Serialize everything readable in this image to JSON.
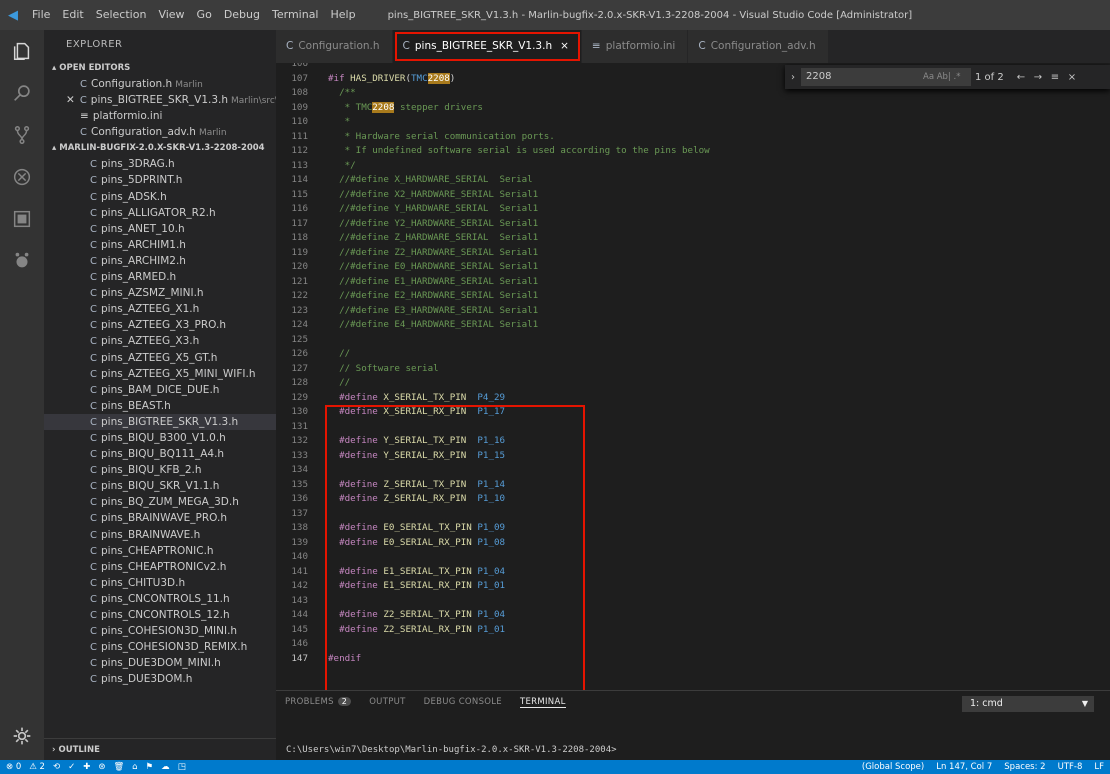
{
  "titlebar": {
    "menu": [
      "File",
      "Edit",
      "Selection",
      "View",
      "Go",
      "Debug",
      "Terminal",
      "Help"
    ],
    "window_title": "pins_BIGTREE_SKR_V1.3.h - Marlin-bugfix-2.0.x-SKR-V1.3-2208-2004 - Visual Studio Code [Administrator]"
  },
  "activity_icons": [
    "files-icon",
    "search-icon",
    "source-control-icon",
    "debug-icon",
    "extensions-icon",
    "remote-icon"
  ],
  "sidebar": {
    "header": "EXPLORER",
    "open_editors_title": "OPEN EDITORS",
    "open_editors": [
      {
        "type": "C",
        "name": "Configuration.h",
        "path": "Marlin",
        "active": false
      },
      {
        "type": "C",
        "name": "pins_BIGTREE_SKR_V1.3.h",
        "path": "Marlin\\src\\p...",
        "active": true
      },
      {
        "type": "≡",
        "name": "platformio.ini",
        "path": "",
        "active": false
      },
      {
        "type": "C",
        "name": "Configuration_adv.h",
        "path": "Marlin",
        "active": false
      }
    ],
    "folder_title": "MARLIN-BUGFIX-2.0.X-SKR-V1.3-2208-2004",
    "files": [
      "pins_3DRAG.h",
      "pins_5DPRINT.h",
      "pins_ADSK.h",
      "pins_ALLIGATOR_R2.h",
      "pins_ANET_10.h",
      "pins_ARCHIM1.h",
      "pins_ARCHIM2.h",
      "pins_ARMED.h",
      "pins_AZSMZ_MINI.h",
      "pins_AZTEEG_X1.h",
      "pins_AZTEEG_X3_PRO.h",
      "pins_AZTEEG_X3.h",
      "pins_AZTEEG_X5_GT.h",
      "pins_AZTEEG_X5_MINI_WIFI.h",
      "pins_BAM_DICE_DUE.h",
      "pins_BEAST.h",
      "pins_BIGTREE_SKR_V1.3.h",
      "pins_BIQU_B300_V1.0.h",
      "pins_BIQU_BQ111_A4.h",
      "pins_BIQU_KFB_2.h",
      "pins_BIQU_SKR_V1.1.h",
      "pins_BQ_ZUM_MEGA_3D.h",
      "pins_BRAINWAVE_PRO.h",
      "pins_BRAINWAVE.h",
      "pins_CHEAPTRONIC.h",
      "pins_CHEAPTRONICv2.h",
      "pins_CHITU3D.h",
      "pins_CNCONTROLS_11.h",
      "pins_CNCONTROLS_12.h",
      "pins_COHESION3D_MINI.h",
      "pins_COHESION3D_REMIX.h",
      "pins_DUE3DOM_MINI.h",
      "pins_DUE3DOM.h"
    ],
    "selected_file": "pins_BIGTREE_SKR_V1.3.h",
    "outline_title": "OUTLINE"
  },
  "tabs": [
    {
      "type": "C",
      "label": "Configuration.h",
      "active": false
    },
    {
      "type": "C",
      "label": "pins_BIGTREE_SKR_V1.3.h",
      "active": true
    },
    {
      "type": "≡",
      "label": "platformio.ini",
      "active": false
    },
    {
      "type": "C",
      "label": "Configuration_adv.h",
      "active": false
    }
  ],
  "find": {
    "query": "2208",
    "options": "Aa  Ab|  .*",
    "count": "1 of 2"
  },
  "code_lines": [
    {
      "n": "106",
      "tokens": []
    },
    {
      "n": "107",
      "tokens": [
        [
          "kw",
          "#if "
        ],
        [
          "mac",
          "HAS_DRIVER"
        ],
        [
          "pl",
          "("
        ],
        [
          "nm",
          "TMC"
        ],
        [
          "hl",
          "2208"
        ],
        [
          "pl",
          ")"
        ]
      ]
    },
    {
      "n": "108",
      "tokens": [
        [
          "cm",
          "  /**"
        ]
      ]
    },
    {
      "n": "109",
      "tokens": [
        [
          "cm",
          "   * TMC"
        ],
        [
          "hl",
          "2208"
        ],
        [
          "cm",
          " stepper drivers"
        ]
      ]
    },
    {
      "n": "110",
      "tokens": [
        [
          "cm",
          "   *"
        ]
      ]
    },
    {
      "n": "111",
      "tokens": [
        [
          "cm",
          "   * Hardware serial communication ports."
        ]
      ]
    },
    {
      "n": "112",
      "tokens": [
        [
          "cm",
          "   * If undefined software serial is used according to the pins below"
        ]
      ]
    },
    {
      "n": "113",
      "tokens": [
        [
          "cm",
          "   */"
        ]
      ]
    },
    {
      "n": "114",
      "tokens": [
        [
          "cm",
          "  //#define X_HARDWARE_SERIAL  Serial"
        ]
      ]
    },
    {
      "n": "115",
      "tokens": [
        [
          "cm",
          "  //#define X2_HARDWARE_SERIAL Serial1"
        ]
      ]
    },
    {
      "n": "116",
      "tokens": [
        [
          "cm",
          "  //#define Y_HARDWARE_SERIAL  Serial1"
        ]
      ]
    },
    {
      "n": "117",
      "tokens": [
        [
          "cm",
          "  //#define Y2_HARDWARE_SERIAL Serial1"
        ]
      ]
    },
    {
      "n": "118",
      "tokens": [
        [
          "cm",
          "  //#define Z_HARDWARE_SERIAL  Serial1"
        ]
      ]
    },
    {
      "n": "119",
      "tokens": [
        [
          "cm",
          "  //#define Z2_HARDWARE_SERIAL Serial1"
        ]
      ]
    },
    {
      "n": "120",
      "tokens": [
        [
          "cm",
          "  //#define E0_HARDWARE_SERIAL Serial1"
        ]
      ]
    },
    {
      "n": "121",
      "tokens": [
        [
          "cm",
          "  //#define E1_HARDWARE_SERIAL Serial1"
        ]
      ]
    },
    {
      "n": "122",
      "tokens": [
        [
          "cm",
          "  //#define E2_HARDWARE_SERIAL Serial1"
        ]
      ]
    },
    {
      "n": "123",
      "tokens": [
        [
          "cm",
          "  //#define E3_HARDWARE_SERIAL Serial1"
        ]
      ]
    },
    {
      "n": "124",
      "tokens": [
        [
          "cm",
          "  //#define E4_HARDWARE_SERIAL Serial1"
        ]
      ]
    },
    {
      "n": "125",
      "tokens": []
    },
    {
      "n": "126",
      "tokens": [
        [
          "cm",
          "  //"
        ]
      ]
    },
    {
      "n": "127",
      "tokens": [
        [
          "cm",
          "  // Software serial"
        ]
      ]
    },
    {
      "n": "128",
      "tokens": [
        [
          "cm",
          "  //"
        ]
      ]
    },
    {
      "n": "129",
      "tokens": [
        [
          "kw",
          "  #define "
        ],
        [
          "mac",
          "X_SERIAL_TX_PIN"
        ],
        [
          "pl",
          "  "
        ],
        [
          "nm",
          "P4_29"
        ]
      ]
    },
    {
      "n": "130",
      "tokens": [
        [
          "kw",
          "  #define "
        ],
        [
          "mac",
          "X_SERIAL_RX_PIN"
        ],
        [
          "pl",
          "  "
        ],
        [
          "nm",
          "P1_17"
        ]
      ]
    },
    {
      "n": "131",
      "tokens": []
    },
    {
      "n": "132",
      "tokens": [
        [
          "kw",
          "  #define "
        ],
        [
          "mac",
          "Y_SERIAL_TX_PIN"
        ],
        [
          "pl",
          "  "
        ],
        [
          "nm",
          "P1_16"
        ]
      ]
    },
    {
      "n": "133",
      "tokens": [
        [
          "kw",
          "  #define "
        ],
        [
          "mac",
          "Y_SERIAL_RX_PIN"
        ],
        [
          "pl",
          "  "
        ],
        [
          "nm",
          "P1_15"
        ]
      ]
    },
    {
      "n": "134",
      "tokens": []
    },
    {
      "n": "135",
      "tokens": [
        [
          "kw",
          "  #define "
        ],
        [
          "mac",
          "Z_SERIAL_TX_PIN"
        ],
        [
          "pl",
          "  "
        ],
        [
          "nm",
          "P1_14"
        ]
      ]
    },
    {
      "n": "136",
      "tokens": [
        [
          "kw",
          "  #define "
        ],
        [
          "mac",
          "Z_SERIAL_RX_PIN"
        ],
        [
          "pl",
          "  "
        ],
        [
          "nm",
          "P1_10"
        ]
      ]
    },
    {
      "n": "137",
      "tokens": []
    },
    {
      "n": "138",
      "tokens": [
        [
          "kw",
          "  #define "
        ],
        [
          "mac",
          "E0_SERIAL_TX_PIN"
        ],
        [
          "pl",
          " "
        ],
        [
          "nm",
          "P1_09"
        ]
      ]
    },
    {
      "n": "139",
      "tokens": [
        [
          "kw",
          "  #define "
        ],
        [
          "mac",
          "E0_SERIAL_RX_PIN"
        ],
        [
          "pl",
          " "
        ],
        [
          "nm",
          "P1_08"
        ]
      ]
    },
    {
      "n": "140",
      "tokens": []
    },
    {
      "n": "141",
      "tokens": [
        [
          "kw",
          "  #define "
        ],
        [
          "mac",
          "E1_SERIAL_TX_PIN"
        ],
        [
          "pl",
          " "
        ],
        [
          "nm",
          "P1_04"
        ]
      ]
    },
    {
      "n": "142",
      "tokens": [
        [
          "kw",
          "  #define "
        ],
        [
          "mac",
          "E1_SERIAL_RX_PIN"
        ],
        [
          "pl",
          " "
        ],
        [
          "nm",
          "P1_01"
        ]
      ]
    },
    {
      "n": "143",
      "tokens": []
    },
    {
      "n": "144",
      "tokens": [
        [
          "kw",
          "  #define "
        ],
        [
          "mac",
          "Z2_SERIAL_TX_PIN"
        ],
        [
          "pl",
          " "
        ],
        [
          "nm",
          "P1_04"
        ]
      ]
    },
    {
      "n": "145",
      "tokens": [
        [
          "kw",
          "  #define "
        ],
        [
          "mac",
          "Z2_SERIAL_RX_PIN"
        ],
        [
          "pl",
          " "
        ],
        [
          "nm",
          "P1_01"
        ]
      ]
    },
    {
      "n": "146",
      "tokens": []
    },
    {
      "n": "147",
      "tokens": [
        [
          "kw",
          "#endif"
        ]
      ],
      "current": true
    }
  ],
  "panel": {
    "tabs": [
      "PROBLEMS",
      "OUTPUT",
      "DEBUG CONSOLE",
      "TERMINAL"
    ],
    "problems_count": "2",
    "active_tab": "TERMINAL",
    "terminal_select": "1: cmd",
    "terminal_line": "C:\\Users\\win7\\Desktop\\Marlin-bugfix-2.0.x-SKR-V1.3-2208-2004>"
  },
  "statusbar": {
    "left": [
      "⊗ 0",
      "⚠ 2",
      "⟲",
      "✓",
      "✚",
      "⊛",
      "🗑",
      "⌂",
      "⚑",
      "☁",
      "◳"
    ],
    "right": [
      "(Global Scope)",
      "Ln 147, Col 7",
      "Spaces: 2",
      "UTF-8",
      "LF"
    ]
  },
  "colors": {
    "accent": "#007acc",
    "highlight_box": "#e51400",
    "find_match": "#a87a1c"
  }
}
